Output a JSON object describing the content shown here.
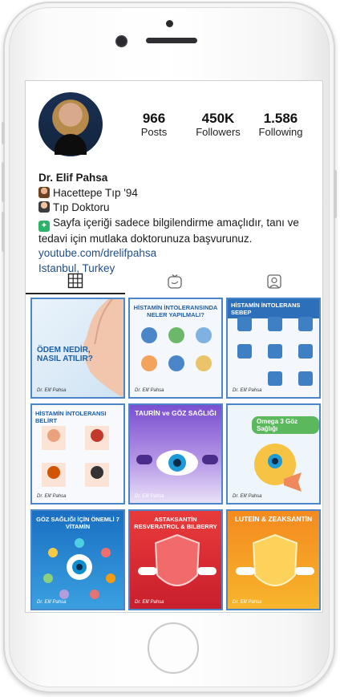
{
  "profile": {
    "stats": [
      {
        "value": "966",
        "label": "Posts"
      },
      {
        "value": "450K",
        "label": "Followers"
      },
      {
        "value": "1.586",
        "label": "Following"
      }
    ],
    "name": "Dr. Elif Pahsa",
    "bio_lines": [
      "Hacettepe Tıp '94",
      "Tıp Doktoru"
    ],
    "notice": "Sayfa içeriği sadece bilgilendirme amaçlıdır, tanı ve tedavi için mutlaka doktorunuza başvurunuz.",
    "link": "youtube.com/drelifpahsa",
    "location": "Istanbul, Turkey"
  },
  "tabs": [
    "grid-icon",
    "igtv-icon",
    "tagged-icon"
  ],
  "posts": [
    {
      "title": "ÖDEM NEDİR, NASIL ATILIR?",
      "signature": "Dr. Elif Pahsa"
    },
    {
      "title": "HİSTAMİN İNTOLERANSINDA NELER YAPILMALI?",
      "signature": "Dr. Elif Pahsa"
    },
    {
      "title": "HİSTAMİN İNTOLERANS SEBEP",
      "signature": "Dr. Elif Pahsa"
    },
    {
      "title": "HİSTAMİN İNTOLERANSI BELİRT",
      "signature": "Dr. Elif Pahsa"
    },
    {
      "title": "TAURİN ve GÖZ SAĞLIĞI",
      "signature": "Dr. Elif Pahsa"
    },
    {
      "title": "Omega 3 Göz Sağlığı",
      "signature": "Dr. Elif Pahsa"
    },
    {
      "title": "GÖZ SAĞLIĞI İÇİN ÖNEMLİ 7 VİTAMİN",
      "signature": "Dr. Elif Pahsa"
    },
    {
      "title": "ASTAKSANTİN RESVERATROL & BILBERRY",
      "signature": "Dr. Elif Pahsa"
    },
    {
      "title": "LUTEİN & ZEAKSANTİN",
      "signature": "Dr. Elif Pahsa"
    }
  ]
}
